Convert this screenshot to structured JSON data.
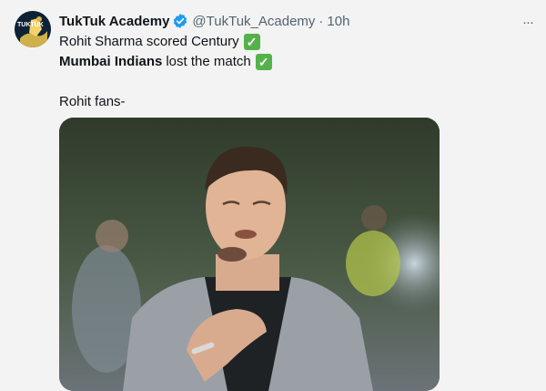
{
  "tweet": {
    "author": {
      "name": "TukTuk Academy",
      "handle": "@TukTuk_Academy",
      "avatar_text": "TUKTUK",
      "verified_icon": "verified-badge-icon",
      "verified_color": "#1d9bf0"
    },
    "separator": "·",
    "timestamp": "10h",
    "more_icon": "more-horizontal-icon",
    "more_label": "···",
    "lines": {
      "line1_text": "Rohit Sharma scored Century",
      "line2_bold": "Mumbai Indians",
      "line2_text": "lost the match",
      "line3_text": "Rohit fans-"
    },
    "check_icon": "check-mark-button-icon",
    "check_glyph": "✓",
    "check_color": "#55b24a",
    "media": {
      "type": "photo",
      "description_icon": "meme-photo-image"
    }
  }
}
